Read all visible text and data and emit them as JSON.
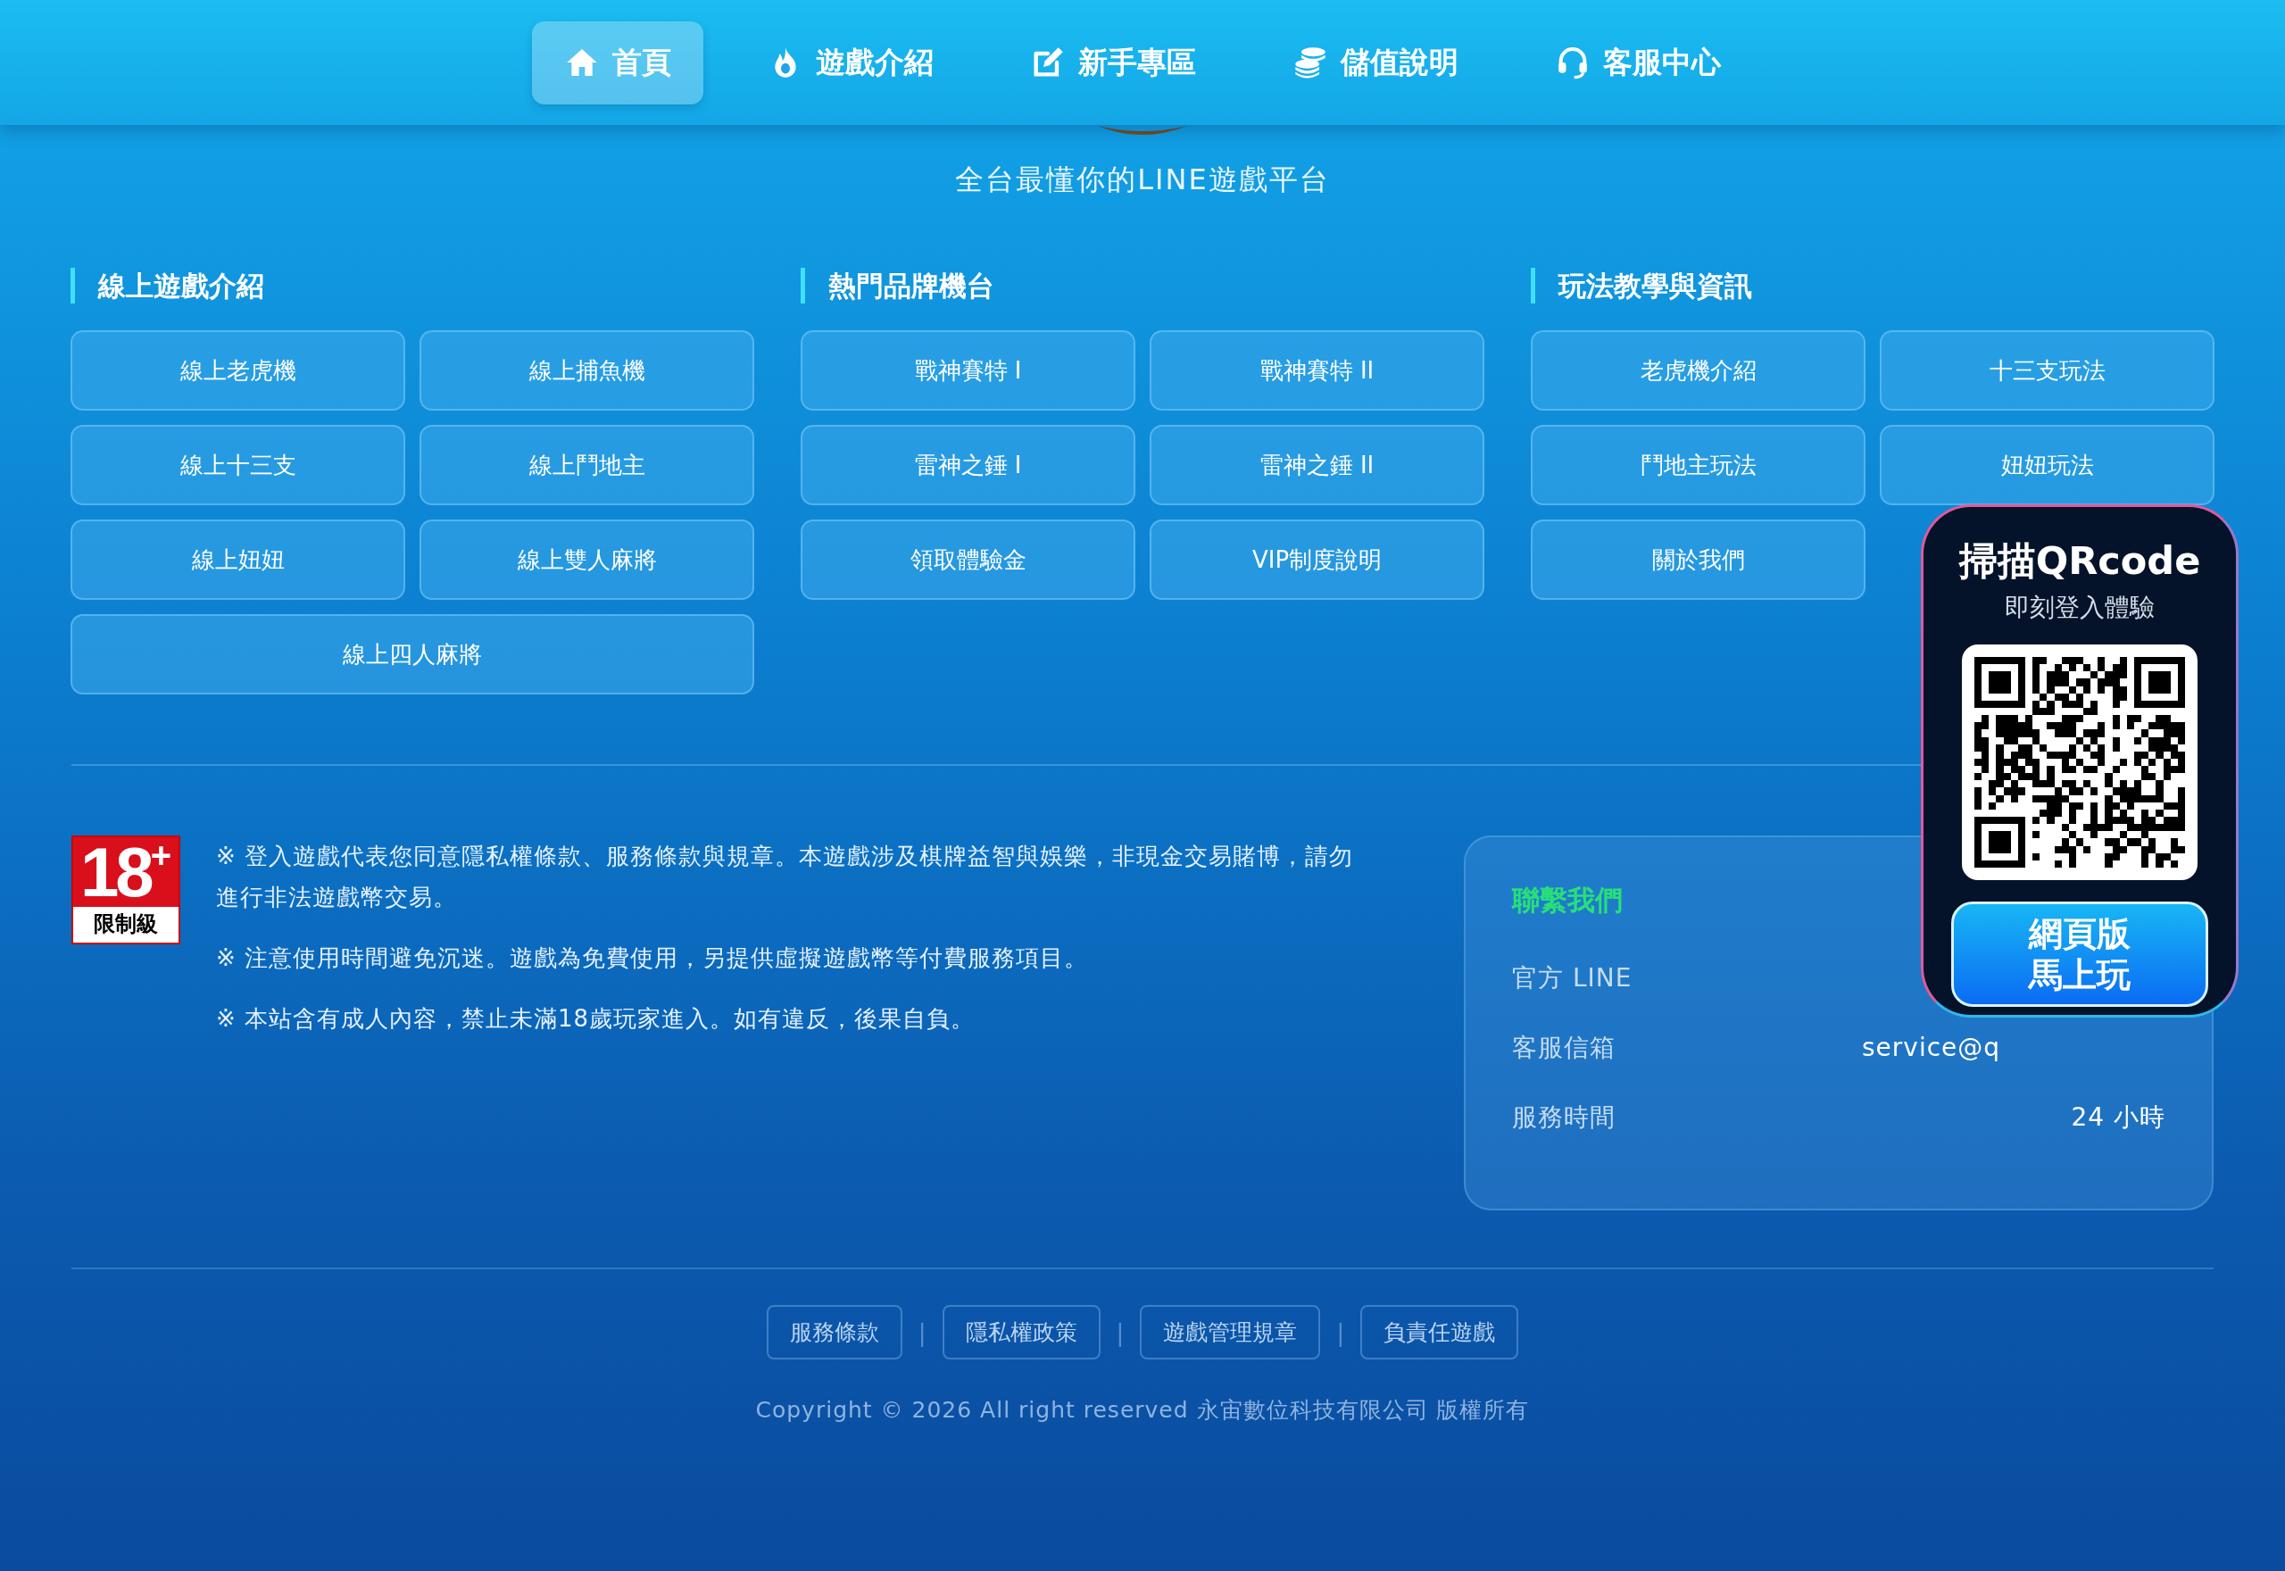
{
  "nav": [
    {
      "label": "首頁",
      "selected": true
    },
    {
      "label": "遊戲介紹",
      "selected": false
    },
    {
      "label": "新手專區",
      "selected": false
    },
    {
      "label": "儲值說明",
      "selected": false
    },
    {
      "label": "客服中心",
      "selected": false
    }
  ],
  "tagline": "全台最懂你的LINE遊戲平台",
  "sections": [
    {
      "title": "線上遊戲介紹",
      "items": [
        {
          "label": "線上老虎機",
          "kind": "normal"
        },
        {
          "label": "線上捕魚機",
          "kind": "normal"
        },
        {
          "label": "線上十三支",
          "kind": "normal"
        },
        {
          "label": "線上鬥地主",
          "kind": "normal"
        },
        {
          "label": "線上妞妞",
          "kind": "normal"
        },
        {
          "label": "線上雙人麻將",
          "kind": "normal"
        },
        {
          "label": "線上四人麻將",
          "kind": "wide"
        }
      ]
    },
    {
      "title": "熱門品牌機台",
      "items": [
        {
          "label": "戰神賽特 I",
          "kind": "normal"
        },
        {
          "label": "戰神賽特 II",
          "kind": "normal"
        },
        {
          "label": "雷神之錘 I",
          "kind": "normal"
        },
        {
          "label": "雷神之錘 II",
          "kind": "normal"
        },
        {
          "label": "領取體驗金",
          "kind": "normal"
        },
        {
          "label": "VIP制度說明",
          "kind": "normal"
        }
      ]
    },
    {
      "title": "玩法教學與資訊",
      "items": [
        {
          "label": "老虎機介紹",
          "kind": "normal"
        },
        {
          "label": "十三支玩法",
          "kind": "normal"
        },
        {
          "label": "鬥地主玩法",
          "kind": "normal"
        },
        {
          "label": "妞妞玩法",
          "kind": "normal"
        },
        {
          "label": "關於我們",
          "kind": "normal"
        }
      ]
    }
  ],
  "age_badge": {
    "number": "18",
    "plus": "+",
    "label": "限制級"
  },
  "notices": [
    "※ 登入遊戲代表您同意隱私權條款、服務條款與規章。本遊戲涉及棋牌益智與娛樂，非現金交易賭博，請勿進行非法遊戲幣交易。",
    "※ 注意使用時間避免沉迷。遊戲為免費使用，另提供虛擬遊戲幣等付費服務項目。",
    "※ 本站含有成人內容，禁止未滿18歲玩家進入。如有違反，後果自負。"
  ],
  "contact": {
    "title": "聯繫我們",
    "rows": [
      {
        "label": "官方 LINE"
      },
      {
        "label": "客服信箱",
        "value": "service@q"
      },
      {
        "label": "服務時間",
        "value": "24 小時"
      }
    ]
  },
  "footer_links": [
    "服務條款",
    "隱私權政策",
    "遊戲管理規章",
    "負責任遊戲"
  ],
  "footer_separator": "|",
  "copyright": "Copyright © 2026 All right reserved 永宙數位科技有限公司 版權所有",
  "qr_panel": {
    "title": "掃描QRcode",
    "subtitle": "即刻登入體驗",
    "button": [
      "網頁版",
      "馬上玩"
    ]
  }
}
